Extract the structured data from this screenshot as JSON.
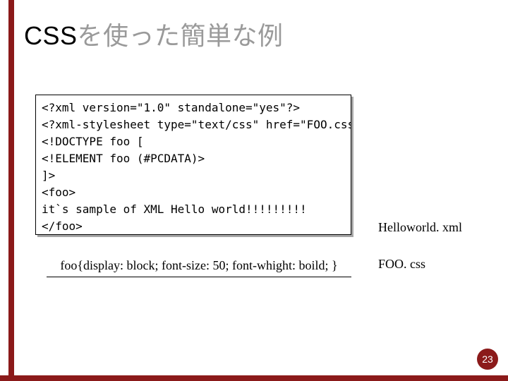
{
  "title": {
    "en": "CSS",
    "jp": "を使った簡単な例"
  },
  "xml_code": "<?xml version=\"1.0\" standalone=\"yes\"?>\n<?xml-stylesheet type=\"text/css\" href=\"FOO.css\"?>\n<!DOCTYPE foo [\n<!ELEMENT foo (#PCDATA)>\n]>\n<foo>\nit`s sample of XML Hello world!!!!!!!!!\n</foo>",
  "xml_label": "Helloworld. xml",
  "css_code": "foo{display: block; font-size: 50; font-whight: boild; }",
  "css_label": "FOO. css",
  "page_number": "23"
}
